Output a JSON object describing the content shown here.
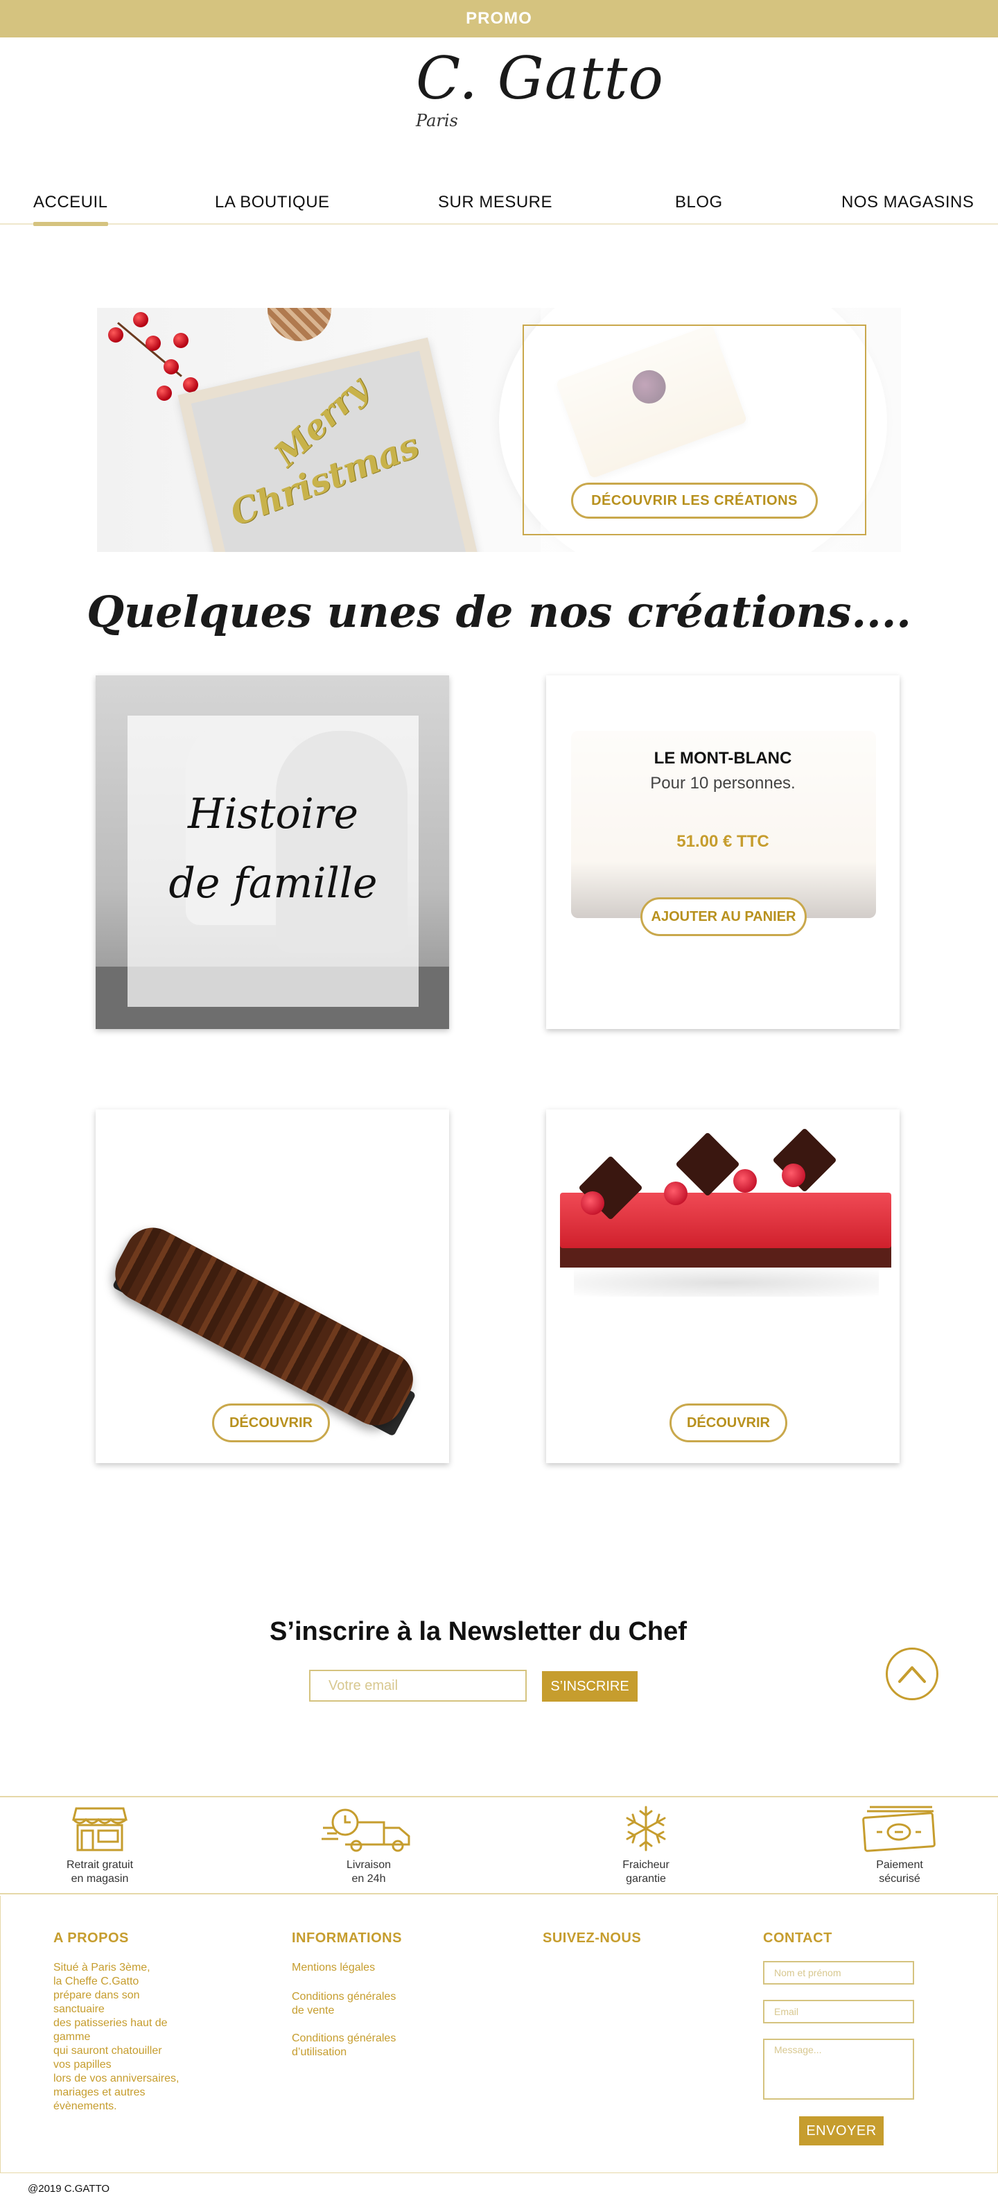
{
  "promo": {
    "label": "PROMO"
  },
  "logo": {
    "name": "C. Gatto",
    "city": "Paris"
  },
  "nav": {
    "items": [
      {
        "label": "ACCEUIL",
        "active": true
      },
      {
        "label": "LA BOUTIQUE"
      },
      {
        "label": "SUR MESURE"
      },
      {
        "label": "BLOG"
      },
      {
        "label": "NOS MAGASINS"
      }
    ]
  },
  "hero": {
    "image_text_1": "Merry",
    "image_text_2": "Christmas",
    "cta_label": "DÉCOUVRIR LES CRÉATIONS"
  },
  "creations": {
    "title": "Quelques unes de nos créations....",
    "family_card": {
      "line1": "Histoire",
      "line2": "de famille"
    },
    "product": {
      "name": "LE MONT-BLANC",
      "description": "Pour 10 personnes.",
      "price": "51.00 € TTC",
      "cta_label": "AJOUTER AU PANIER"
    },
    "discover_label": "DÉCOUVRIR"
  },
  "newsletter": {
    "title": "S’inscrire à la Newsletter du Chef",
    "placeholder": "Votre email",
    "button_label": "S’INSCRIRE"
  },
  "features": [
    {
      "icon": "shop-icon",
      "label": "Retrait gratuit\nen magasin"
    },
    {
      "icon": "delivery-truck-icon",
      "label": "Livraison\nen 24h"
    },
    {
      "icon": "snowflake-icon",
      "label": "Fraicheur\ngarantie"
    },
    {
      "icon": "banknote-icon",
      "label": "Paiement\nsécurisé"
    }
  ],
  "footer": {
    "about": {
      "title": "A PROPOS",
      "text": "Situé à Paris 3ème,\nla Cheffe C.Gatto\nprépare dans son\nsanctuaire\ndes patisseries haut de\ngamme\nqui sauront chatouiller\nvos papilles\nlors de vos anniversaires,\nmariages et autres\névènements."
    },
    "informations": {
      "title": "INFORMATIONS",
      "links": [
        "Mentions légales",
        "Conditions générales\nde vente",
        "Conditions générales\nd’utilisation"
      ]
    },
    "social": {
      "title": "SUIVEZ-NOUS"
    },
    "contact": {
      "title": "CONTACT",
      "name_placeholder": "Nom et prénom",
      "email_placeholder": "Email",
      "message_placeholder": "Message...",
      "send_label": "ENVOYER"
    }
  },
  "copyright": "@2019 C.GATTO",
  "colors": {
    "gold": "#c69d2e",
    "promo_bg": "#d5c37f",
    "border": "#e6d8a8"
  }
}
